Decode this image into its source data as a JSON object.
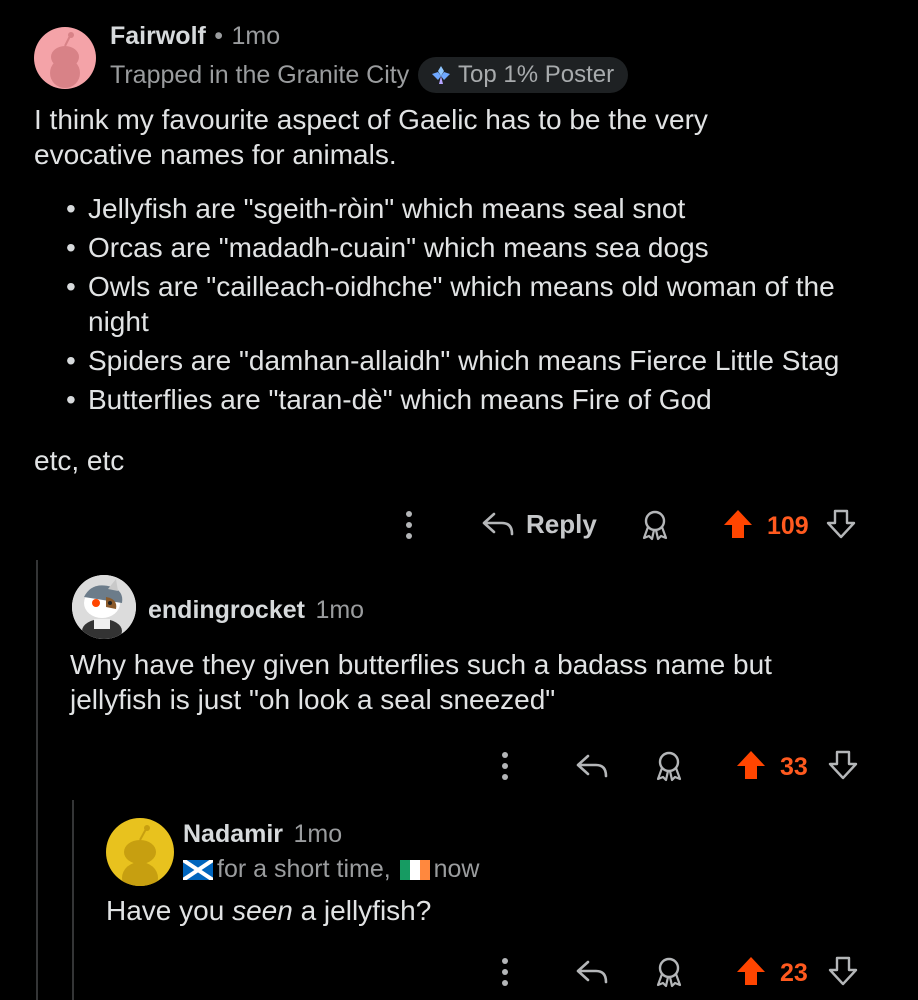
{
  "comments": [
    {
      "username": "Fairwolf",
      "separator": "•",
      "age": "1mo",
      "flair": "Trapped in the Granite City",
      "badge": "Top 1% Poster",
      "intro": "I think my favourite aspect of Gaelic has to be the very evocative names for animals.",
      "bullets": [
        "Jellyfish are \"sgeith-ròin\" which means seal snot",
        "Orcas are \"madadh-cuain\" which means sea dogs",
        "Owls are \"cailleach-oidhche\" which means old woman of the night",
        "Spiders are \"damhan-allaidh\" which means Fierce Little Stag",
        "Butterflies are \"taran-dè\" which means Fire of God"
      ],
      "outro": "etc, etc",
      "reply_label": "Reply",
      "votes": "109",
      "avatar_color": "#f4a3a8"
    },
    {
      "username": "endingrocket",
      "age": "1mo",
      "text": "Why have they given butterflies such a badass name but jellyfish is just \"oh look a seal sneezed\"",
      "votes": "33"
    },
    {
      "username": "Nadamir",
      "age": "1mo",
      "flair_text_1": "for a short time,",
      "flair_text_2": "now",
      "text_before": "Have you ",
      "text_emph": "seen",
      "text_after": " a jellyfish?",
      "votes": "23",
      "avatar_color": "#e8c21e"
    }
  ],
  "colors": {
    "upvote": "#ff4500",
    "background": "#000000"
  },
  "icons": [
    "overflow-dots-icon",
    "reply-arrow-icon",
    "award-icon",
    "upvote-arrow-icon",
    "downvote-arrow-icon",
    "scotland-flag-icon",
    "ireland-flag-icon",
    "top-poster-badge-icon"
  ]
}
